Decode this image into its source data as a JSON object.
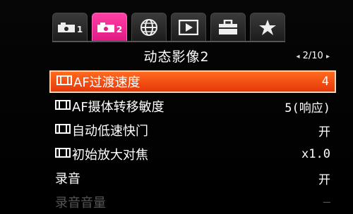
{
  "tabs": [
    {
      "icon": "camera-icon",
      "number": "1",
      "active": false
    },
    {
      "icon": "camera-icon",
      "number": "2",
      "active": true
    },
    {
      "icon": "globe-icon",
      "number": "",
      "active": false
    },
    {
      "icon": "playback-icon",
      "number": "",
      "active": false
    },
    {
      "icon": "toolbox-icon",
      "number": "",
      "active": false
    },
    {
      "icon": "star-icon",
      "number": "",
      "active": false
    }
  ],
  "header": {
    "title": "动态影像2",
    "page": "2/10",
    "prev_arrow": "◂",
    "next_arrow": "▸"
  },
  "menu": {
    "items": [
      {
        "label": "AF过渡速度",
        "value": "4",
        "movie_icon": true,
        "selected": true
      },
      {
        "label": "AF摄体转移敏度",
        "value": "5(响应)",
        "movie_icon": true,
        "selected": false
      },
      {
        "label": "自动低速快门",
        "value": "开",
        "movie_icon": true,
        "selected": false
      },
      {
        "label": "初始放大对焦",
        "value": "x1.0",
        "movie_icon": true,
        "selected": false
      },
      {
        "label": "录音",
        "value": "开",
        "movie_icon": false,
        "selected": false
      },
      {
        "label": "录音音量",
        "value": "–",
        "movie_icon": false,
        "selected": false
      }
    ]
  },
  "colors": {
    "tab_active": "#e01a86",
    "selection": "#e6380a",
    "background": "#000000"
  }
}
